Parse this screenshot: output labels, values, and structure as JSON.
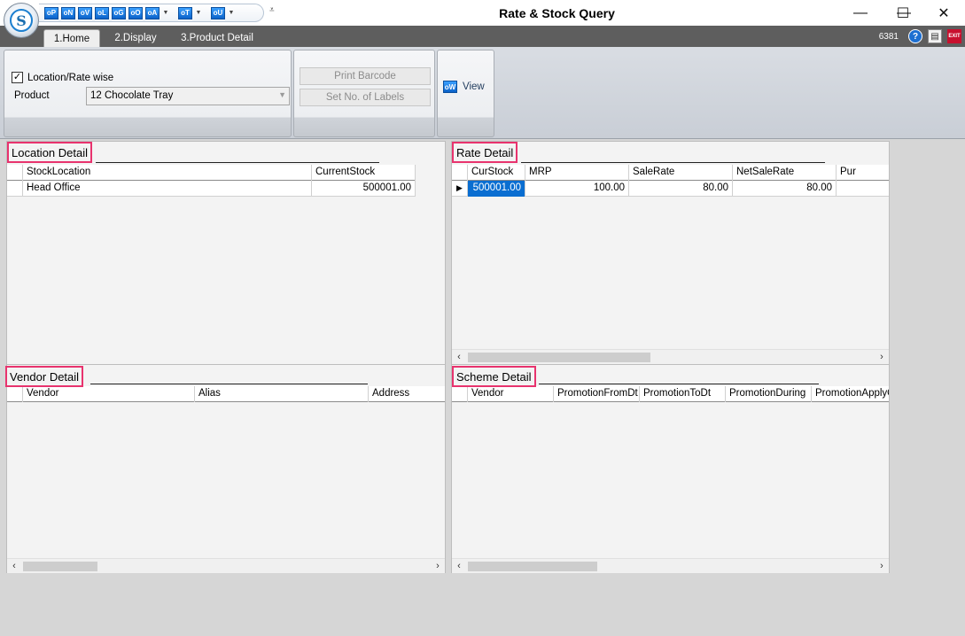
{
  "window": {
    "title": "Rate & Stock Query",
    "minimize": "—",
    "maximize": "☐",
    "close": "✕"
  },
  "app_logo": "S",
  "quick_access": {
    "buttons": [
      "oP",
      "oN",
      "oV",
      "oL",
      "oG",
      "oO",
      "oA",
      "oT",
      "oU"
    ],
    "more": "⩡"
  },
  "tabs": [
    {
      "label": "1.Home",
      "active": true
    },
    {
      "label": "2.Display",
      "active": false
    },
    {
      "label": "3.Product Detail",
      "active": false
    }
  ],
  "toolbar_right": {
    "user_code": "6381",
    "help_icon": "?",
    "doc_icon": "▤",
    "exit_icon": "EXIT"
  },
  "ribbon": {
    "location_rate_wise": {
      "label": "Location/Rate wise",
      "checked": true,
      "mark": "✓"
    },
    "product_label": "Product",
    "product_value": "12 Chocolate Tray",
    "print_barcode": "Print Barcode",
    "set_labels": "Set No. of Labels",
    "view_label": "View",
    "view_icon_text": "oW"
  },
  "location_detail": {
    "title": "Location Detail",
    "columns": [
      "StockLocation",
      "CurrentStock"
    ],
    "rows": [
      [
        "Head Office",
        "500001.00"
      ]
    ]
  },
  "rate_detail": {
    "title": "Rate Detail",
    "columns": [
      "CurStock",
      "MRP",
      "SaleRate",
      "NetSaleRate",
      "Pur"
    ],
    "rows": [
      [
        "500001.00",
        "100.00",
        "80.00",
        "80.00",
        ""
      ]
    ],
    "row_marker": "▶",
    "scroll_left": "‹",
    "scroll_right": "›"
  },
  "vendor_detail": {
    "title": "Vendor Detail",
    "columns": [
      "Vendor",
      "Alias",
      "Address"
    ],
    "scroll_left": "‹",
    "scroll_right": "›"
  },
  "scheme_detail": {
    "title": "Scheme Detail",
    "columns": [
      "Vendor",
      "PromotionFromDt",
      "PromotionToDt",
      "PromotionDuring",
      "PromotionApplyOn"
    ],
    "scroll_left": "‹",
    "scroll_right": "›"
  },
  "colors": {
    "tabbar": "#5e5e5e",
    "highlight_border": "#e8336e",
    "selection": "#0a6ed1"
  }
}
